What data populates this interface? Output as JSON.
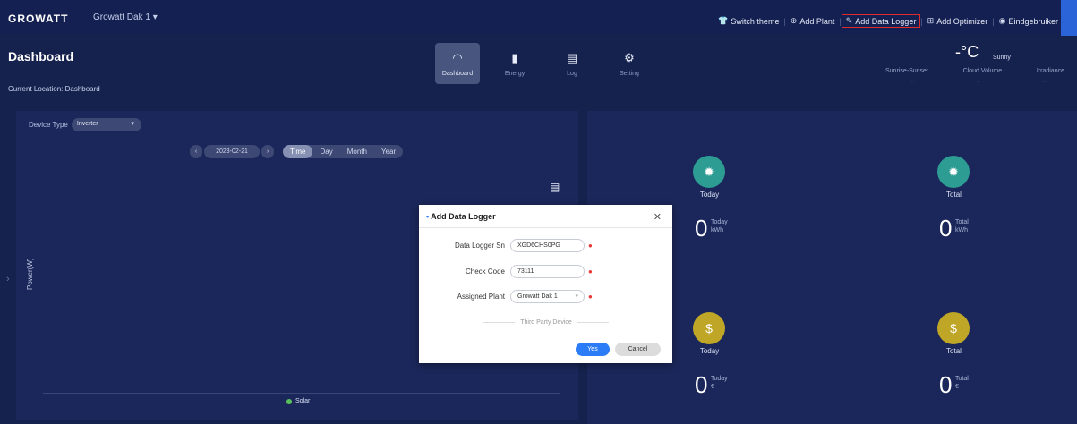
{
  "header": {
    "brand": "GROWATT",
    "plant_name": "Growatt Dak 1",
    "plant_dropdown_icon": "chevron-down-icon",
    "nav": [
      {
        "icon": "shirt-icon",
        "label": "Switch theme"
      },
      {
        "icon": "plus-circle-icon",
        "label": "Add Plant"
      },
      {
        "icon": "pencil-icon",
        "label": "Add Data Logger",
        "highlighted": true,
        "highlight_color": "#e02b2b"
      },
      {
        "icon": "optimizer-icon",
        "label": "Add Optimizer"
      },
      {
        "icon": "user-circle-icon",
        "label": "Eindgebruiker"
      }
    ]
  },
  "page": {
    "title": "Dashboard",
    "location": "Current Location: Dashboard"
  },
  "nav_tiles": [
    {
      "icon": "gauge-icon",
      "label": "Dashboard",
      "active": true
    },
    {
      "icon": "bar-chart-icon",
      "label": "Energy",
      "active": false
    },
    {
      "icon": "log-icon",
      "label": "Log",
      "active": false
    },
    {
      "icon": "gear-icon",
      "label": "Setting",
      "active": false
    }
  ],
  "weather": {
    "temperature": "-°C",
    "condition": "Sunny",
    "labels": [
      "Sunrise-Sunset",
      "Cloud Volume",
      "Irradiance"
    ],
    "values": [
      "--",
      "--",
      "--"
    ]
  },
  "chart_panel": {
    "device_type_label": "Device Type",
    "device_type_value": "Inverter",
    "date": "2023-02-21",
    "ranges": [
      "Time",
      "Day",
      "Month",
      "Year"
    ],
    "active_range": "Time",
    "ylabel": "Power(W)",
    "legend": "Solar",
    "legend_color": "#59c15a"
  },
  "stats": [
    {
      "icon": "sun-icon",
      "color": "#2d9c93",
      "label": "Today",
      "value": "0",
      "sub_label": "Today",
      "unit": "kWh"
    },
    {
      "icon": "sun-icon",
      "color": "#2d9c93",
      "label": "Total",
      "value": "0",
      "sub_label": "Total",
      "unit": "kWh"
    },
    {
      "icon": "coin-icon",
      "color": "#c0a627",
      "label": "Today",
      "value": "0",
      "sub_label": "Today",
      "unit": "€"
    },
    {
      "icon": "coin-icon",
      "color": "#c0a627",
      "label": "Total",
      "value": "0",
      "sub_label": "Total",
      "unit": "€"
    }
  ],
  "modal": {
    "title": "Add Data Logger",
    "fields": [
      {
        "label": "Data Logger Sn",
        "value": "XGD6CHS0PG",
        "required": true
      },
      {
        "label": "Check Code",
        "value": "73111",
        "required": true
      },
      {
        "label": "Assigned Plant",
        "value": "Growatt Dak 1",
        "required": true
      }
    ],
    "third_party": "Third Party Device",
    "yes_label": "Yes",
    "cancel_label": "Cancel"
  },
  "colors": {
    "background": "#16224e",
    "panel": "#1b275a",
    "accent": "#2b7cf6"
  }
}
